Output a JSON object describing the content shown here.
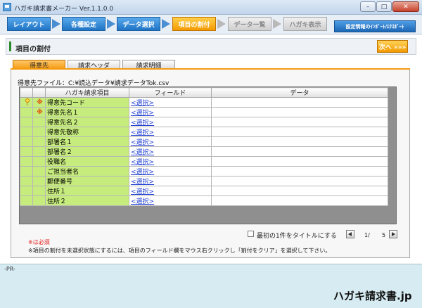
{
  "window": {
    "title": "ハガキ請求書メーカー Ver.1.1.0.0"
  },
  "steps": [
    {
      "label": "レイアウト",
      "state": "done"
    },
    {
      "label": "各種設定",
      "state": "done"
    },
    {
      "label": "データ選択",
      "state": "done"
    },
    {
      "label": "項目の割付",
      "state": "active"
    },
    {
      "label": "データ一覧",
      "state": "disabled"
    },
    {
      "label": "ハガキ表示",
      "state": "disabled"
    }
  ],
  "settings_button": "設定情報のｲﾝﾎﾟｰﾄ/ｴｸｽﾎﾟｰﾄ",
  "section": {
    "title": "項目の割付",
    "next_label": "次へ »»»"
  },
  "tabs": [
    {
      "label": "得意先",
      "active": true
    },
    {
      "label": "請求ヘッダ",
      "active": false
    },
    {
      "label": "請求明細",
      "active": false
    }
  ],
  "file_label": "得意先ファイル：C:¥読込データ¥請求データTok.csv",
  "grid": {
    "headers": {
      "item": "ハガキ請求項目",
      "field": "フィールド",
      "data": "データ"
    },
    "rows": [
      {
        "key": true,
        "required": "※",
        "item": "得意先コード",
        "field": "<選択>",
        "data": ""
      },
      {
        "key": false,
        "required": "※",
        "item": "得意先名１",
        "field": "<選択>",
        "data": ""
      },
      {
        "key": false,
        "required": "",
        "item": "得意先名２",
        "field": "<選択>",
        "data": ""
      },
      {
        "key": false,
        "required": "",
        "item": "得意先敬称",
        "field": "<選択>",
        "data": ""
      },
      {
        "key": false,
        "required": "",
        "item": "部署名１",
        "field": "<選択>",
        "data": ""
      },
      {
        "key": false,
        "required": "",
        "item": "部署名２",
        "field": "<選択>",
        "data": ""
      },
      {
        "key": false,
        "required": "",
        "item": "役職名",
        "field": "<選択>",
        "data": ""
      },
      {
        "key": false,
        "required": "",
        "item": "ご担当者名",
        "field": "<選択>",
        "data": ""
      },
      {
        "key": false,
        "required": "",
        "item": "郵便番号",
        "field": "<選択>",
        "data": ""
      },
      {
        "key": false,
        "required": "",
        "item": "住所１",
        "field": "<選択>",
        "data": ""
      },
      {
        "key": false,
        "required": "",
        "item": "住所２",
        "field": "<選択>",
        "data": ""
      }
    ]
  },
  "title_checkbox": {
    "label": "最初の1件をタイトルにする",
    "checked": false
  },
  "pager": {
    "current": "1/",
    "total": "5"
  },
  "notes": {
    "required": "※は必須",
    "help": "※項目の割付を未選択状態にするには、項目のフィールド欄をマウス右クリックし「割付をクリア」を選択して下さい。"
  },
  "footer": {
    "pr_label": "-PR-",
    "brand": "ハガキ請求書.jp"
  },
  "icons": {
    "app": "app-icon",
    "key": "key-icon",
    "arrow": "arrow-right-icon"
  }
}
